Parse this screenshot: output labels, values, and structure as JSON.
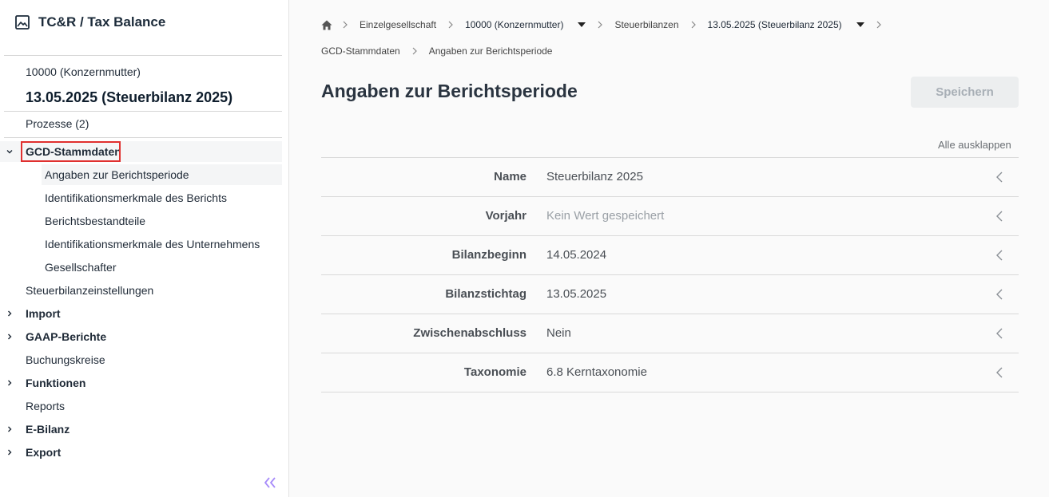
{
  "app": {
    "title": "TC&R / Tax Balance"
  },
  "sidebar": {
    "entity": "10000 (Konzernmutter)",
    "period": "13.05.2025 (Steuerbilanz 2025)",
    "processes": "Prozesse (2)",
    "gcd": "GCD-Stammdaten",
    "sub_items": [
      "Angaben zur Berichtsperiode",
      "Identifikationsmerkmale des Berichts",
      "Berichtsbestandteile",
      "Identifikationsmerkmale des Unternehmens",
      "Gesellschafter"
    ],
    "items": [
      "Steuerbilanzeinstellungen",
      "Import",
      "GAAP-Berichte",
      "Buchungskreise",
      "Funktionen",
      "Reports",
      "E-Bilanz",
      "Export"
    ]
  },
  "breadcrumb": {
    "row1": [
      "Einzelgesellschaft",
      "10000 (Konzernmutter)",
      "Steuerbilanzen",
      "13.05.2025 (Steuerbilanz 2025)"
    ],
    "row2": [
      "GCD-Stammdaten",
      "Angaben zur Berichtsperiode"
    ]
  },
  "page": {
    "title": "Angaben zur Berichtsperiode",
    "save": "Speichern",
    "expand_all": "Alle ausklappen"
  },
  "fields": [
    {
      "label": "Name",
      "value": "Steuerbilanz 2025"
    },
    {
      "label": "Vorjahr",
      "value": "Kein Wert gespeichert"
    },
    {
      "label": "Bilanzbeginn",
      "value": "14.05.2024"
    },
    {
      "label": "Bilanzstichtag",
      "value": "13.05.2025"
    },
    {
      "label": "Zwischenabschluss",
      "value": "Nein"
    },
    {
      "label": "Taxonomie",
      "value": "6.8 Kerntaxonomie"
    }
  ],
  "colors": {
    "highlight": "#e0302f",
    "collapse_icon": "#a78bfa"
  }
}
